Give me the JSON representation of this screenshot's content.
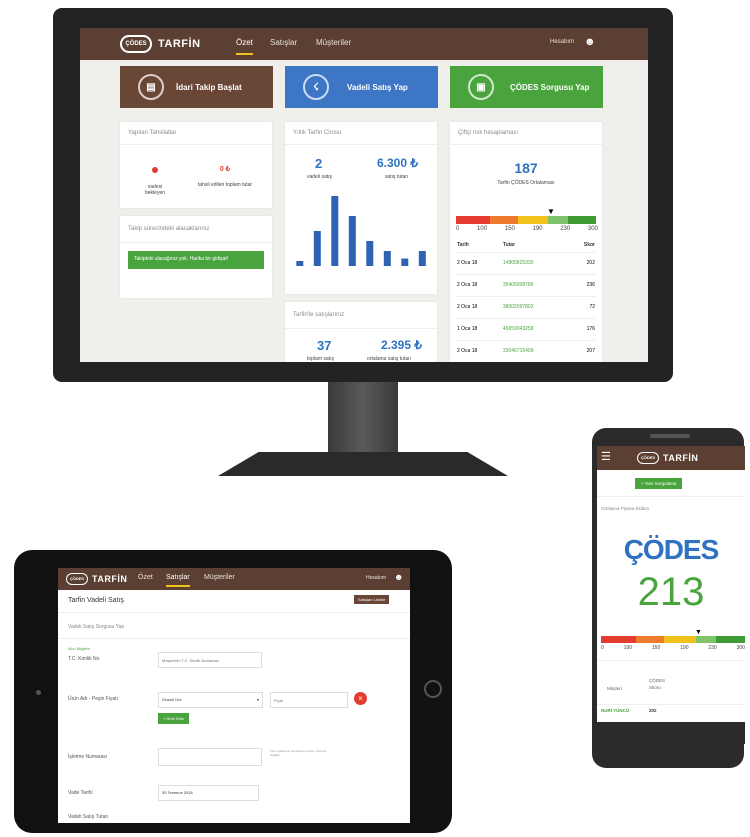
{
  "brand": {
    "name": "TARFİN",
    "mark": "ÇÖDES"
  },
  "desktop": {
    "nav": {
      "items": [
        "Özet",
        "Satışlar",
        "Müşteriler"
      ],
      "active": 0,
      "user": "Hesabım"
    },
    "actions": [
      {
        "label": "İdari Takip Başlat",
        "color": "#6a4637"
      },
      {
        "label": "Vadeli Satış Yap",
        "color": "#3d76c5"
      },
      {
        "label": "ÇÖDES Sorgusu Yap",
        "color": "#4aa43e"
      }
    ],
    "collections": {
      "title": "Yapılan Tahsilatlar",
      "stats": [
        {
          "value": "0",
          "label": "vadesi bekleyen"
        },
        {
          "value": "0 ₺",
          "label": "tahsil edilen toplam tutar"
        }
      ]
    },
    "tracking": {
      "title": "Takip sürecindeki alacaklarınız",
      "alert": "Takipteki alacağınız yok. Harika bir gidişat!"
    },
    "annual": {
      "title": "Yıllık Tarfin Cirosu",
      "count": "2",
      "count_label": "vadeli satış",
      "amount": "6.300 ₺",
      "amount_label": "satış tutarı"
    },
    "sales_card": {
      "title": "Tarfin'le satışlarınız",
      "count": "37",
      "count_label": "toplam satış",
      "amount": "2.395 ₺",
      "amount_label": "ortalama satış tutarı"
    },
    "farmers": {
      "title": "Çiftçi risk hesaplaması",
      "score": "187",
      "score_label": "Tarfin ÇÖDES Ortalaması",
      "scale": [
        "0",
        "100",
        "150",
        "190",
        "230",
        "300"
      ],
      "columns": [
        "Tarih",
        "Tutar",
        "Skor"
      ],
      "rows": [
        {
          "date": "2 Oca 18",
          "tc": "14805825330",
          "score": "202"
        },
        {
          "date": "2 Oca 18",
          "tc": "35405008786",
          "score": "236"
        },
        {
          "date": "2 Oca 18",
          "tc": "38002097802",
          "score": "72"
        },
        {
          "date": "1 Oca 18",
          "tc": "45059043258",
          "score": "176"
        },
        {
          "date": "2 Oca 18",
          "tc": "33046715409",
          "score": "207"
        }
      ]
    }
  },
  "chart_data": {
    "type": "bar",
    "categories": [
      "",
      "",
      "",
      "",
      "",
      "",
      "",
      ""
    ],
    "values": [
      2,
      14,
      28,
      20,
      10,
      6,
      3,
      6
    ],
    "title": "",
    "xlabel": "",
    "ylabel": ""
  },
  "tablet": {
    "nav": {
      "items": [
        "Özet",
        "Satışlar",
        "Müşteriler"
      ],
      "active": 1,
      "user": "Hesabım"
    },
    "page_title": "Tarfin Vadeli Satış",
    "list_button": "Satışları Listele",
    "section": "Vadeli Satış Sorgusu Yap",
    "subsection": "Alıcı Bilgileri",
    "tc_label": "T.C. Kimlik No",
    "tc_placeholder": "Müşterinin T.C. Kimlik Numarası",
    "product_label": "Ürün Adı - Peşin Fiyatı",
    "product_value": "Granül Üre",
    "price_placeholder": "Fiyat",
    "add_button": "+ Ürün Ekle",
    "note_label": "İşletme Numarası",
    "note_help": "Tarım işletmesi numaranızı giriniz. Zorunlu değildir.",
    "date_label": "Vade Tarihi",
    "date_value": "30 Temmuz 2018",
    "total_label": "Vadeli Satış Tutarı"
  },
  "phone": {
    "new_query": "+ Yeni Sorgulama",
    "subtitle": "Ortalama Piyasa Ekibim",
    "big_label": "ÇÖDES",
    "big_score": "213",
    "scale": [
      "0",
      "100",
      "150",
      "190",
      "230",
      "300"
    ],
    "col1": "Müşteri",
    "col2": "ÇÖDES Skoru",
    "name": "NURİ YÜNCÜ",
    "score": "202"
  }
}
